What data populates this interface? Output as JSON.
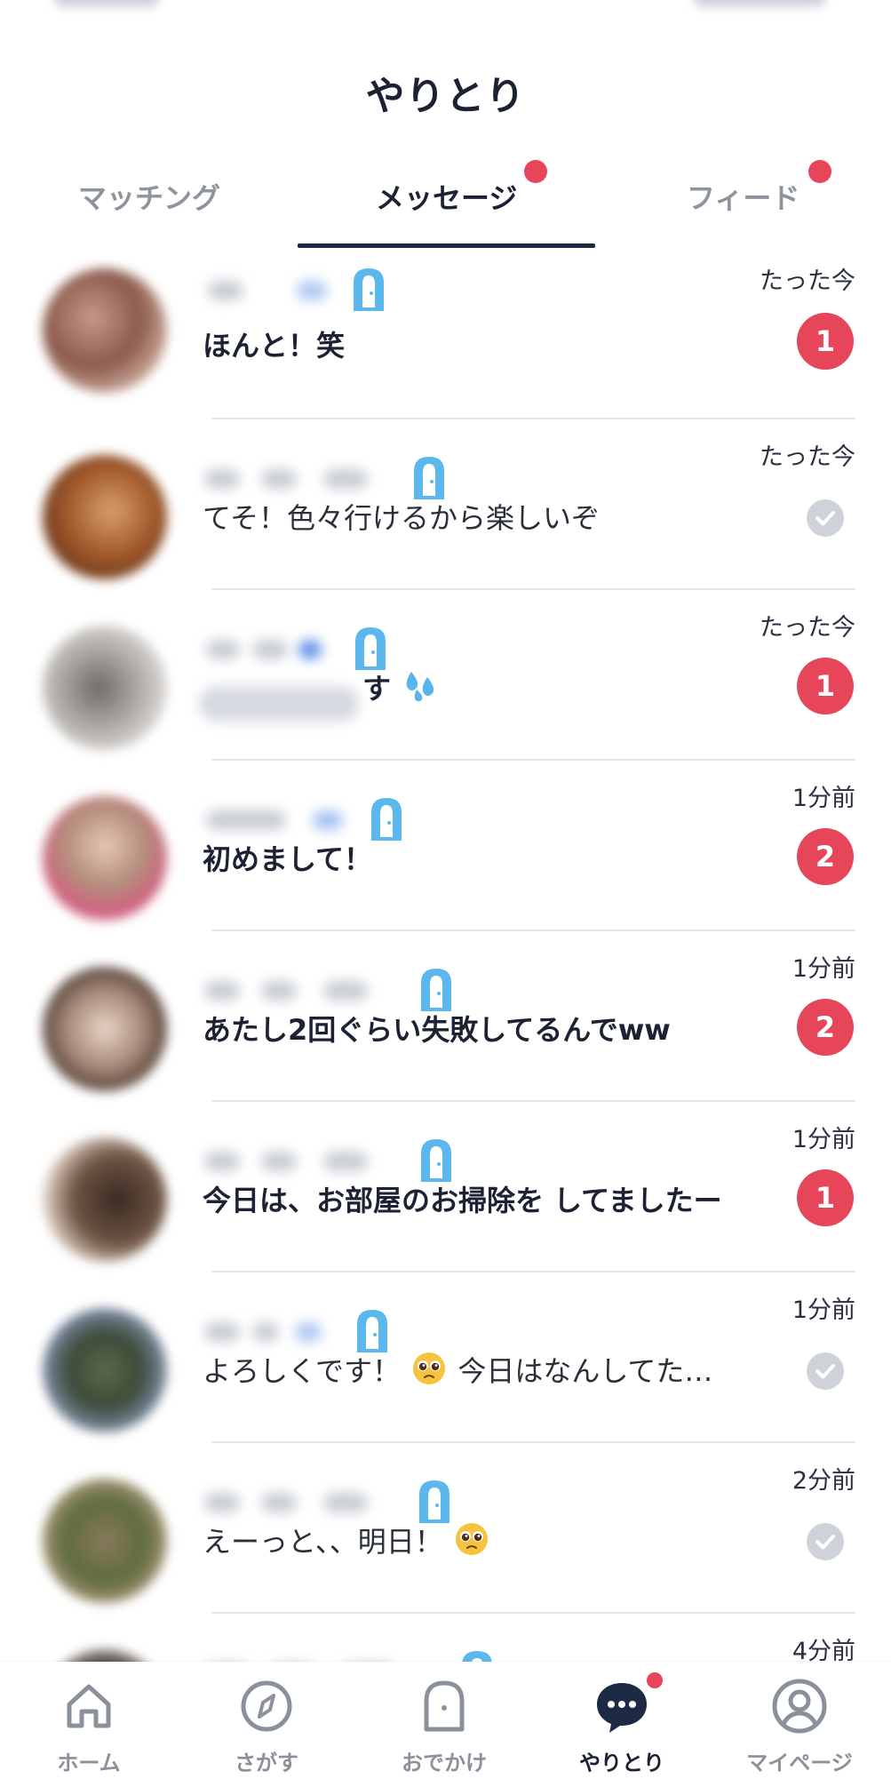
{
  "header": {
    "title": "やりとり"
  },
  "tabs": [
    {
      "label": "マッチング",
      "active": false,
      "dot": false
    },
    {
      "label": "メッセージ",
      "active": true,
      "dot": true
    },
    {
      "label": "フィード",
      "active": false,
      "dot": true
    }
  ],
  "conversations": [
    {
      "message": "ほんと！笑",
      "time": "たった今",
      "unread": "1"
    },
    {
      "message": "てそ！色々行けるから楽しいぞ",
      "time": "たった今",
      "unread": null
    },
    {
      "message": "す",
      "time": "たった今",
      "unread": "1"
    },
    {
      "message": "初めまして！",
      "time": "1分前",
      "unread": "2"
    },
    {
      "message": "あたし2回ぐらい失敗してるんでww",
      "time": "1分前",
      "unread": "2"
    },
    {
      "message": "今日は、お部屋のお掃除を してましたー",
      "time": "1分前",
      "unread": "1"
    },
    {
      "message_before_emoji": "よろしくです！",
      "message_after_emoji": " 今日はなんしてた…",
      "time": "1分前",
      "unread": null
    },
    {
      "message_before_emoji": "えーっと、、明日！",
      "message_after_emoji": "",
      "time": "2分前",
      "unread": null
    },
    {
      "message": "",
      "time": "4分前",
      "unread": null
    }
  ],
  "tabbar": [
    {
      "label": "ホーム",
      "icon": "home-icon",
      "active": false
    },
    {
      "label": "さがす",
      "icon": "compass-icon",
      "active": false
    },
    {
      "label": "おでかけ",
      "icon": "door-icon",
      "active": false
    },
    {
      "label": "やりとり",
      "icon": "chat-bubble-icon",
      "active": true,
      "dot": true
    },
    {
      "label": "マイページ",
      "icon": "profile-icon",
      "active": false
    }
  ],
  "colors": {
    "accent_red": "#e6455a",
    "navy": "#1c2a44",
    "door_blue": "#5cb8ec",
    "inactive_gray": "#8e949e"
  }
}
